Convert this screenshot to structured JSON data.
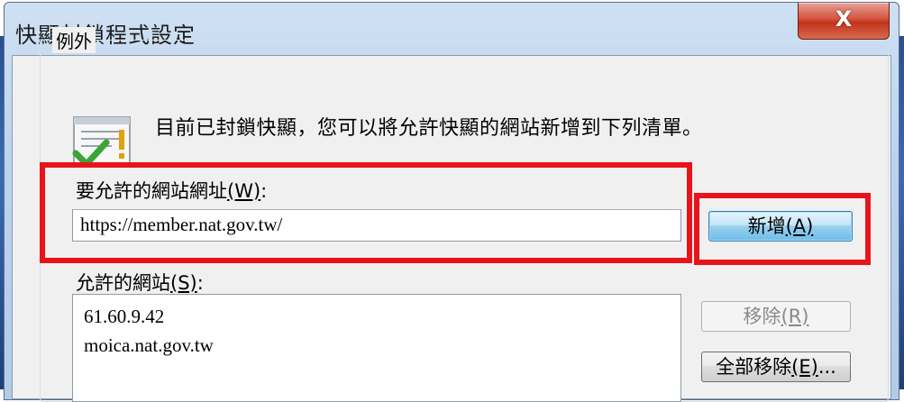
{
  "window": {
    "title": "快顯封鎖程式設定",
    "close_symbol": "X"
  },
  "exceptions": {
    "group_label": "例外",
    "info_text": "目前已封鎖快顯，您可以將允許快顯的網站新增到下列清單。",
    "address_label": "要允許的網站網址",
    "address_hotkey": "(W)",
    "address_label_suffix": ":",
    "address_value": "https://member.nat.gov.tw/",
    "add_button": {
      "label": "新增",
      "hotkey": "(A)"
    },
    "allowed_label": "允許的網站",
    "allowed_hotkey": "(S)",
    "allowed_label_suffix": ":",
    "allowed_sites": [
      "61.60.9.42",
      "moica.nat.gov.tw"
    ],
    "remove_button": {
      "label": "移除",
      "hotkey": "(R)"
    },
    "remove_all_button": {
      "label": "全部移除",
      "hotkey": "(E)",
      "ellipsis": "..."
    }
  },
  "colors": {
    "highlight": "#e8141b",
    "close_button": "#c1341c"
  }
}
